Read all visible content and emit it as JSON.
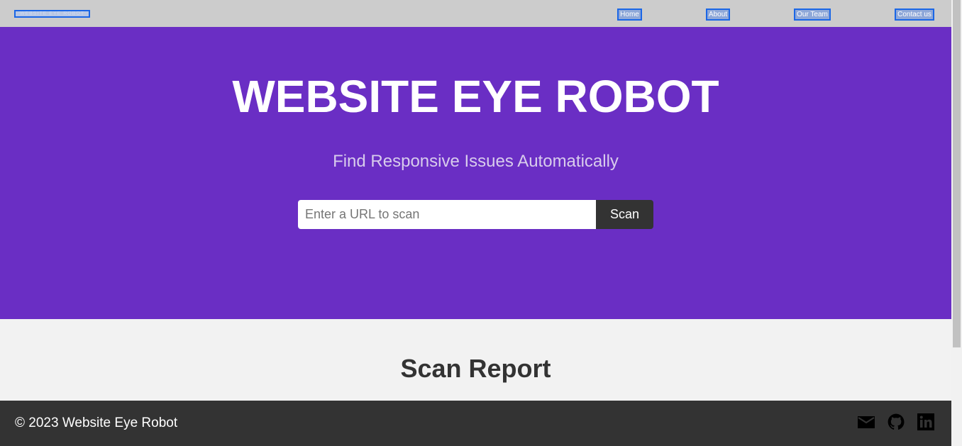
{
  "nav": {
    "logo_text": "WEBSITE EYE ROBOT",
    "links": [
      "Home",
      "About",
      "Our Team",
      "Contact us"
    ]
  },
  "hero": {
    "title": "WEBSITE EYE ROBOT",
    "subtitle": "Find Responsive Issues Automatically",
    "search": {
      "placeholder": "Enter a URL to scan",
      "value": "",
      "button_label": "Scan"
    }
  },
  "report": {
    "title": "Scan Report"
  },
  "footer": {
    "copyright": "© 2023 Website Eye Robot",
    "icons": [
      "mail-icon",
      "github-icon",
      "linkedin-icon"
    ]
  },
  "colors": {
    "hero_bg": "#6a2ec4",
    "nav_bg": "#cccccc",
    "footer_bg": "#333333",
    "button_bg": "#333333",
    "highlight_border": "#1a66e6"
  }
}
